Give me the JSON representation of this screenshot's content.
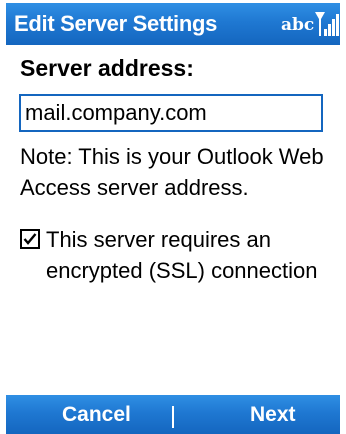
{
  "title_bar": {
    "title": "Edit Server Settings",
    "input_mode": "abc",
    "signal_icon": "signal-strength-icon"
  },
  "form": {
    "server_label": "Server address:",
    "server_value": "mail.company.com",
    "note": "Note: This is your Outlook Web Access server address.",
    "ssl_checkbox": {
      "checked": true,
      "label": "This server requires an encrypted (SSL) connection"
    }
  },
  "softkeys": {
    "left": "Cancel",
    "right": "Next"
  },
  "colors": {
    "bar_blue": "#1f78d2",
    "field_border": "#1466bf"
  }
}
